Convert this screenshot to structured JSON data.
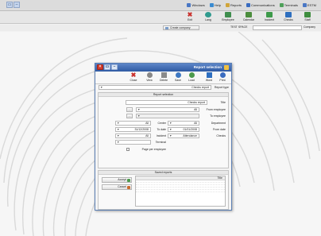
{
  "titlebar": {
    "menu": [
      {
        "label": "ESTM",
        "icon": "app-icon",
        "color": "#4a77c4"
      },
      {
        "label": "Terminals",
        "icon": "terminal-icon",
        "color": "#4fa05a"
      },
      {
        "label": "Communications",
        "icon": "network-icon",
        "color": "#3a6cc0"
      },
      {
        "label": "Reports",
        "icon": "reports-icon",
        "color": "#d0a53a"
      },
      {
        "label": "Help",
        "icon": "help-icon",
        "color": "#3a8bd0"
      },
      {
        "label": "Windows",
        "icon": "windows-icon",
        "color": "#4a77c4"
      }
    ]
  },
  "toolbar": {
    "items": [
      {
        "label": "Staff",
        "icon": "staff-icon",
        "color": "#3e8d3e"
      },
      {
        "label": "Checks",
        "icon": "checks-icon",
        "color": "#2e6fbf"
      },
      {
        "label": "Incident",
        "icon": "incident-icon",
        "color": "#3d9a4a"
      },
      {
        "label": "Calendar",
        "icon": "calendar-icon",
        "color": "#4b8d3d"
      },
      {
        "label": "Employee",
        "icon": "employee-icon",
        "color": "#3f8e4e"
      },
      {
        "label": "Lang",
        "icon": "language-icon",
        "color": "#2f9a8e"
      },
      {
        "label": "Exit",
        "icon": "exit-icon",
        "color": "#c9302c"
      }
    ]
  },
  "inforow": {
    "company_label": "Company",
    "company_value": "",
    "db_label": "TEST SPACE",
    "company_button": "Create company"
  },
  "dialog": {
    "title": "Report selection",
    "tools": [
      {
        "label": "Print",
        "icon": "print-icon",
        "color": "#3a6cc0"
      },
      {
        "label": "Word",
        "icon": "word-icon",
        "color": "#2d6ec0"
      },
      {
        "label": "Load",
        "icon": "load-icon",
        "color": "#4c9a4c"
      },
      {
        "label": "Save",
        "icon": "save-icon",
        "color": "#3e78c2"
      },
      {
        "label": "Delete",
        "icon": "delete-icon",
        "color": "#8a8a8a"
      },
      {
        "label": "View",
        "icon": "view-icon",
        "color": "#888888"
      },
      {
        "label": "Close",
        "icon": "close-icon",
        "color": "#c9302c"
      }
    ],
    "report_type_label": "Report type",
    "report_type_value": "Checks report",
    "selection_header": "Report selection",
    "fields": {
      "title_label": "Title",
      "title_value": "Checks report",
      "from_employee_label": "From employee",
      "from_employee_value": "All",
      "to_employee_label": "To employee",
      "to_employee_value": "",
      "department_label": "Department",
      "department_value": "All",
      "center_label": "Center",
      "center_value": "All",
      "from_date_label": "From date",
      "from_date_value": "01/01/2008",
      "to_date_label": "To date",
      "to_date_value": "31/12/2008",
      "checks_label": "Checks",
      "checks_value": "Attendance",
      "incident_label": "Incident",
      "incident_value": "All",
      "terminal_label": "Terminal",
      "terminal_value": "",
      "page_per_employee_label": "Page per employee",
      "page_per_employee_checked": false
    },
    "saved_header": "Saved reports",
    "saved_col": "Title",
    "accept_label": "Accept",
    "cancel_label": "Cancel"
  }
}
